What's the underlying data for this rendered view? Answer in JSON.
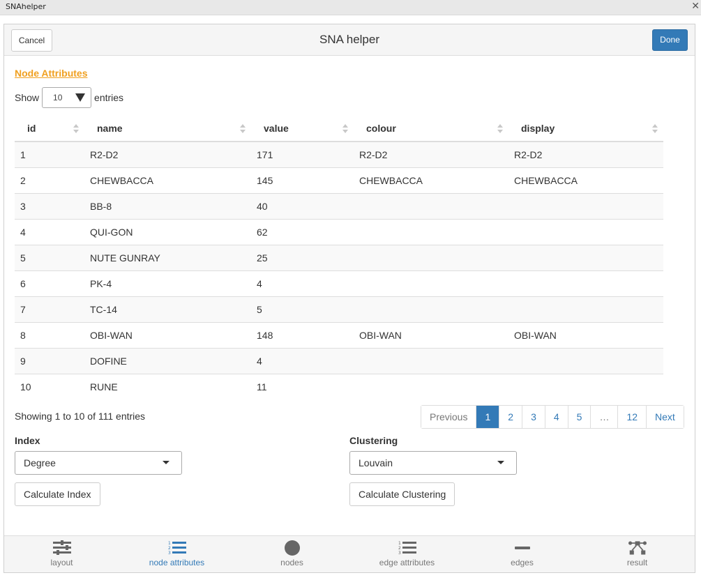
{
  "window": {
    "title": "SNAhelper",
    "close_glyph": "✕"
  },
  "gadget": {
    "title": "SNA helper",
    "cancel_label": "Cancel",
    "done_label": "Done",
    "accent_color": "#337ab7"
  },
  "section": {
    "title": "Node Attributes",
    "title_color": "#f0a020"
  },
  "length": {
    "show_label": "Show",
    "value": "10",
    "entries_label": "entries"
  },
  "table": {
    "columns": [
      "id",
      "name",
      "value",
      "colour",
      "display"
    ],
    "rows": [
      [
        "1",
        "R2-D2",
        "171",
        "R2-D2",
        "R2-D2"
      ],
      [
        "2",
        "CHEWBACCA",
        "145",
        "CHEWBACCA",
        "CHEWBACCA"
      ],
      [
        "3",
        "BB-8",
        "40",
        "",
        ""
      ],
      [
        "4",
        "QUI-GON",
        "62",
        "",
        ""
      ],
      [
        "5",
        "NUTE GUNRAY",
        "25",
        "",
        ""
      ],
      [
        "6",
        "PK-4",
        "4",
        "",
        ""
      ],
      [
        "7",
        "TC-14",
        "5",
        "",
        ""
      ],
      [
        "8",
        "OBI-WAN",
        "148",
        "OBI-WAN",
        "OBI-WAN"
      ],
      [
        "9",
        "DOFINE",
        "4",
        "",
        ""
      ],
      [
        "10",
        "RUNE",
        "11",
        "",
        ""
      ]
    ]
  },
  "info": "Showing 1 to 10 of 111 entries",
  "pagination": {
    "previous": "Previous",
    "pages": [
      "1",
      "2",
      "3",
      "4",
      "5",
      "…",
      "12"
    ],
    "active": "1",
    "next": "Next"
  },
  "index": {
    "label": "Index",
    "selected": "Degree",
    "button": "Calculate Index"
  },
  "clustering": {
    "label": "Clustering",
    "selected": "Louvain",
    "button": "Calculate Clustering"
  },
  "nav": {
    "items": [
      {
        "label": "layout",
        "icon": "sliders-icon",
        "active": false
      },
      {
        "label": "node attributes",
        "icon": "list-ol-icon",
        "active": true
      },
      {
        "label": "nodes",
        "icon": "circle-icon",
        "active": false
      },
      {
        "label": "edge attributes",
        "icon": "list-ol-icon",
        "active": false
      },
      {
        "label": "edges",
        "icon": "minus-icon",
        "active": false
      },
      {
        "label": "result",
        "icon": "project-diagram-icon",
        "active": false
      }
    ]
  }
}
